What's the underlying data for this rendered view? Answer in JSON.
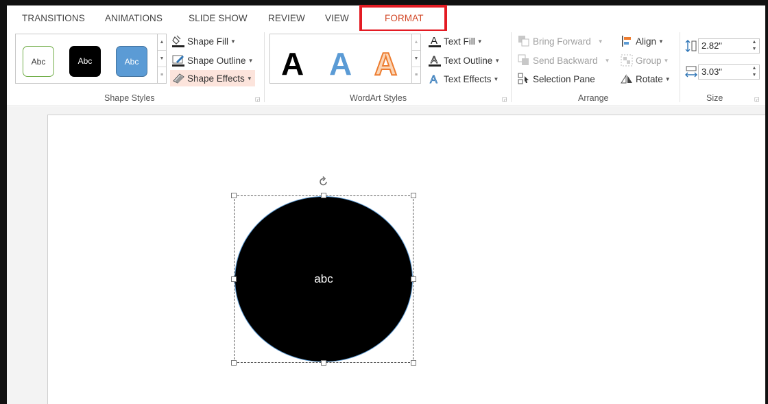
{
  "tabs": {
    "transitions": "TRANSITIONS",
    "animations": "ANIMATIONS",
    "slide_show": "SLIDE SHOW",
    "review": "REVIEW",
    "view": "VIEW",
    "format": "FORMAT"
  },
  "shape_styles": {
    "label": "Shape Styles",
    "swatches": [
      "Abc",
      "Abc",
      "Abc"
    ],
    "shape_fill": "Shape Fill",
    "shape_outline": "Shape Outline",
    "shape_effects": "Shape Effects"
  },
  "wordart_styles": {
    "label": "WordArt Styles",
    "samples": [
      "A",
      "A",
      "A"
    ],
    "text_fill": "Text Fill",
    "text_outline": "Text Outline",
    "text_effects": "Text Effects"
  },
  "arrange": {
    "label": "Arrange",
    "bring_forward": "Bring Forward",
    "send_backward": "Send Backward",
    "selection_pane": "Selection Pane",
    "align": "Align",
    "group": "Group",
    "rotate": "Rotate"
  },
  "size": {
    "label": "Size",
    "height": "2.82\"",
    "width": "3.03\""
  },
  "slide": {
    "shape_text": "abc"
  },
  "colors": {
    "format_tab": "#d24726",
    "highlight_box": "#e31b23",
    "active_button_bg": "#fce4dc",
    "shape_fill": "#000000",
    "shape_outline": "#5b9bd5"
  },
  "icons": {
    "shape_fill": "paint-bucket-icon",
    "shape_outline": "pencil-outline-icon",
    "shape_effects": "effects-icon",
    "text_fill": "text-fill-icon",
    "text_outline": "text-outline-icon",
    "text_effects": "text-effects-icon",
    "bring_forward": "bring-forward-icon",
    "send_backward": "send-backward-icon",
    "selection_pane": "selection-pane-icon",
    "align": "align-icon",
    "group": "group-icon",
    "rotate": "rotate-icon",
    "height": "shape-height-icon",
    "width": "shape-width-icon"
  }
}
